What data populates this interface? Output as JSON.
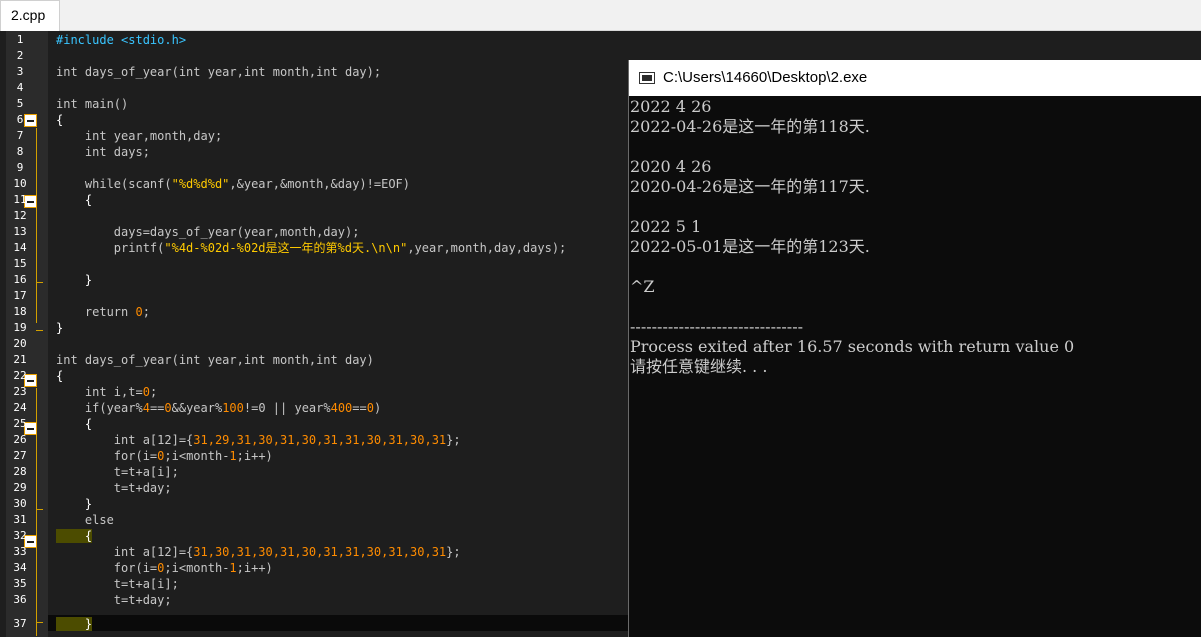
{
  "tab": {
    "label": "2.cpp"
  },
  "editor": {
    "lines": [
      {
        "n": "1"
      },
      {
        "n": "2"
      },
      {
        "n": "3"
      },
      {
        "n": "4"
      },
      {
        "n": "5"
      },
      {
        "n": "6"
      },
      {
        "n": "7"
      },
      {
        "n": "8"
      },
      {
        "n": "9"
      },
      {
        "n": "10"
      },
      {
        "n": "11"
      },
      {
        "n": "12"
      },
      {
        "n": "13"
      },
      {
        "n": "14"
      },
      {
        "n": "15"
      },
      {
        "n": "16"
      },
      {
        "n": "17"
      },
      {
        "n": "18"
      },
      {
        "n": "19"
      },
      {
        "n": "20"
      },
      {
        "n": "21"
      },
      {
        "n": "22"
      },
      {
        "n": "23"
      },
      {
        "n": "24"
      },
      {
        "n": "25"
      },
      {
        "n": "26"
      },
      {
        "n": "27"
      },
      {
        "n": "28"
      },
      {
        "n": "29"
      },
      {
        "n": "30"
      },
      {
        "n": "31"
      },
      {
        "n": "32"
      },
      {
        "n": "33"
      },
      {
        "n": "34"
      },
      {
        "n": "35"
      },
      {
        "n": "36"
      },
      {
        "n": "37"
      }
    ],
    "code": {
      "l1": "#include <stdio.h>",
      "l3": "int days_of_year(int year,int month,int day);",
      "l5": "int main()",
      "l6": "{",
      "l7": "    int year,month,day;",
      "l8": "    int days;",
      "l10a": "    while(scanf(",
      "l10b": "\"%d%d%d\"",
      "l10c": ",&year,&month,&day)!=EOF)",
      "l11": "    {",
      "l13": "        days=days_of_year(year,month,day);",
      "l14a": "        printf(",
      "l14b": "\"%4d-%02d-%02d是这一年的第%d天.\\n\\n\"",
      "l14c": ",year,month,day,days);",
      "l16": "    }",
      "l18a": "    return ",
      "l18b": "0",
      "l18c": ";",
      "l19": "}",
      "l21": "int days_of_year(int year,int month,int day)",
      "l22": "{",
      "l23a": "    int i,t=",
      "l23b": "0",
      "l23c": ";",
      "l24a": "    if(year%",
      "l24b": "4",
      "l24c": "==",
      "l24d": "0",
      "l24e": "&&year%",
      "l24f": "100",
      "l24g": "!=0 || year%",
      "l24h": "400",
      "l24i": "==",
      "l24j": "0",
      "l24k": ")",
      "l25": "    {",
      "l26a": "        int a[12]={",
      "l26b": "31,29,31,30,31,30,31,31,30,31,30,31",
      "l26c": "};",
      "l27a": "        for(i=",
      "l27b": "0",
      "l27c": ";i<month-",
      "l27d": "1",
      "l27e": ";i++)",
      "l28": "        t=t+a[i];",
      "l29": "        t=t+day;",
      "l30": "    }",
      "l31": "    else",
      "l32": "    {",
      "l33a": "        int a[12]={",
      "l33b": "31,30,31,30,31,30,31,31,30,31,30,31",
      "l33c": "};",
      "l34a": "        for(i=",
      "l34b": "0",
      "l34c": ";i<month-",
      "l34d": "1",
      "l34e": ";i++)",
      "l35": "        t=t+a[i];",
      "l36": "        t=t+day;",
      "l37": "    }"
    }
  },
  "console": {
    "title": "C:\\Users\\14660\\Desktop\\2.exe",
    "lines": [
      "2022 4 26",
      "2022-04-26是这一年的第118天.",
      "",
      "2020 4 26",
      "2020-04-26是这一年的第117天.",
      "",
      "2022 5 1",
      "2022-05-01是这一年的第123天.",
      "",
      "^Z",
      "",
      "--------------------------------",
      "Process exited after 16.57 seconds with return value 0",
      "请按任意键继续. . ."
    ]
  },
  "colors": {
    "editor_bg": "#1e1e1e",
    "string": "#ffca00",
    "number": "#ff8c00",
    "preprocessor": "#39c5ff",
    "fold_marker": "#e9a000",
    "console_bg": "#0c0c0c",
    "console_text": "#cccccc"
  }
}
